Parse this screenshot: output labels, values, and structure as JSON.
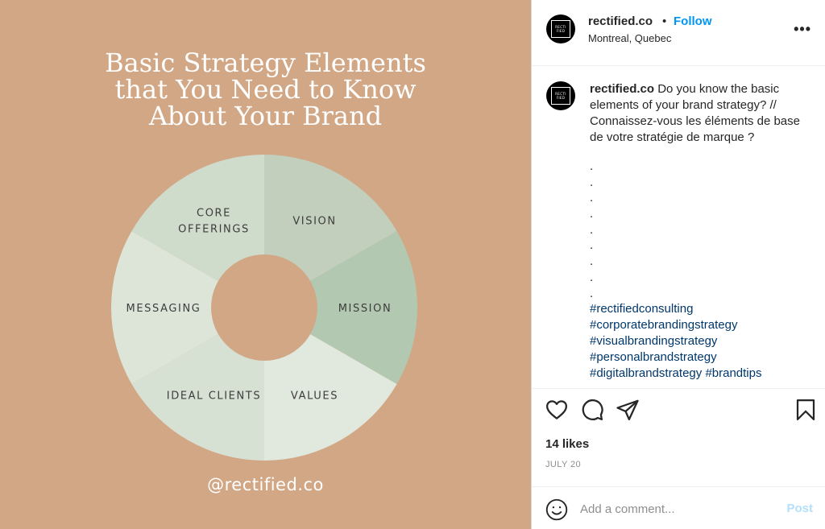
{
  "post_image": {
    "title_lines": [
      "Basic Strategy Elements",
      "that You Need to Know",
      "About Your Brand"
    ],
    "segments": [
      {
        "label_lines": [
          "VISION"
        ],
        "color": "#c2cfbd"
      },
      {
        "label_lines": [
          "MISSION"
        ],
        "color": "#b3c8b1"
      },
      {
        "label_lines": [
          "VALUES"
        ],
        "color": "#e1e8dd"
      },
      {
        "label_lines": [
          "IDEAL CLIENTS"
        ],
        "color": "#d7e1d3"
      },
      {
        "label_lines": [
          "MESSAGING"
        ],
        "color": "#dde5d9"
      },
      {
        "label_lines": [
          "CORE",
          "OFFERINGS"
        ],
        "color": "#cfdbcb"
      }
    ],
    "handle": "@rectified.co",
    "background_color": "#d1a785"
  },
  "header": {
    "avatar_text": [
      "RECTI",
      "FIED"
    ],
    "username": "rectified.co",
    "separator": "•",
    "follow_label": "Follow",
    "location": "Montreal, Quebec",
    "more_label": "•••"
  },
  "caption": {
    "username": "rectified.co",
    "text": "Do you know the basic elements of your brand strategy? // Connaissez-vous les éléments de base de votre stratégie de marque ?",
    "dots": [
      ".",
      ".",
      ".",
      ".",
      ".",
      ".",
      ".",
      ".",
      "."
    ],
    "hashtags": [
      "#rectifiedconsulting",
      "#corporatebrandingstrategy",
      "#visualbrandingstrategy",
      "#personalbrandstrategy",
      "#digitalbrandstrategy",
      "#brandtips"
    ]
  },
  "actions": {
    "icons": [
      "heart-icon",
      "comment-icon",
      "share-icon",
      "bookmark-icon"
    ]
  },
  "likes": "14 likes",
  "date": "JULY 20",
  "comment_box": {
    "placeholder": "Add a comment...",
    "post_label": "Post",
    "emoji_icon": "emoji-icon"
  },
  "colors": {
    "follow": "#0095f6",
    "hashtag": "#00376b",
    "post_disabled": "#b2dffc"
  }
}
